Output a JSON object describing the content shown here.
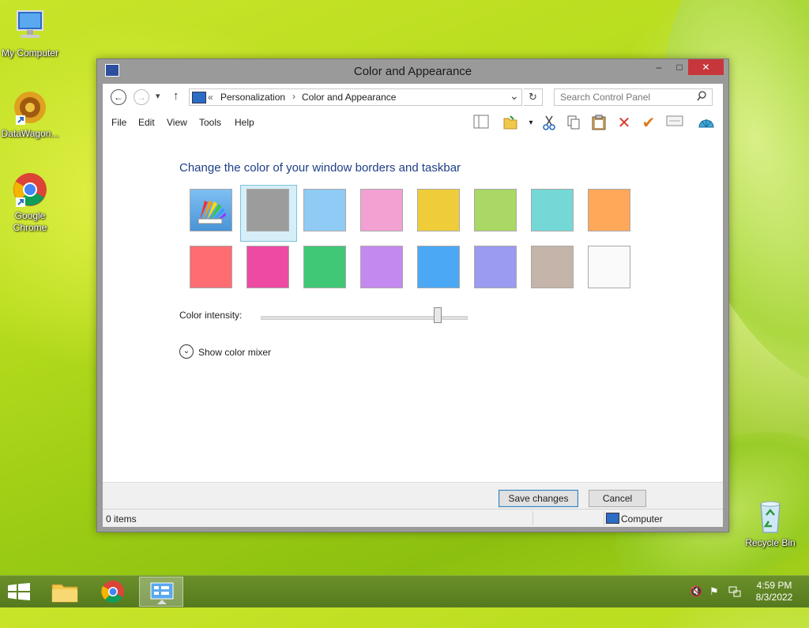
{
  "desktop": {
    "icons": [
      {
        "label": "My Computer"
      },
      {
        "label": "DataWagon..."
      },
      {
        "label": "Google Chrome"
      },
      {
        "label": "Recycle Bin"
      }
    ]
  },
  "window": {
    "title": "Color and Appearance",
    "controls": {
      "minimize": "–",
      "maximize": "□",
      "close": "✕"
    }
  },
  "navbar": {
    "back": "←",
    "forward": "→",
    "recent": "▾",
    "up": "↑",
    "breadcrumb_prefix": "«",
    "breadcrumb": [
      "Personalization",
      "Color and Appearance"
    ],
    "breadcrumb_sep": "›",
    "dropdown": "⌄",
    "refresh": "↻",
    "search_placeholder": "Search Control Panel"
  },
  "menu": {
    "items": [
      "File",
      "Edit",
      "View",
      "Tools",
      "Help"
    ]
  },
  "content": {
    "heading": "Change the color of your window borders and taskbar",
    "colors_row1": [
      "custom",
      "#9c9c9c",
      "#8fcbf5",
      "#f3a0d3",
      "#efcd3a",
      "#a9d865",
      "#74d8d6",
      "#ffa85a"
    ],
    "colors_row2": [
      "#ff6d73",
      "#ee4aa3",
      "#40c877",
      "#c489ef",
      "#4aa8f5",
      "#9b9bf2",
      "#c4b4a9",
      "#fafafa"
    ],
    "selected_index": 1,
    "intensity_label": "Color intensity:",
    "intensity_value": 0.86,
    "mixer_toggle": "⌄",
    "mixer_label": "Show color mixer"
  },
  "buttons": {
    "save": "Save changes",
    "cancel": "Cancel"
  },
  "status": {
    "items": "0 items",
    "location": "Computer"
  },
  "taskbar": {
    "time": "4:59 PM",
    "date": "8/3/2022"
  },
  "colors": {
    "accent": "#1e3f87",
    "close": "#c7363a",
    "frame": "#9a9a9a"
  }
}
